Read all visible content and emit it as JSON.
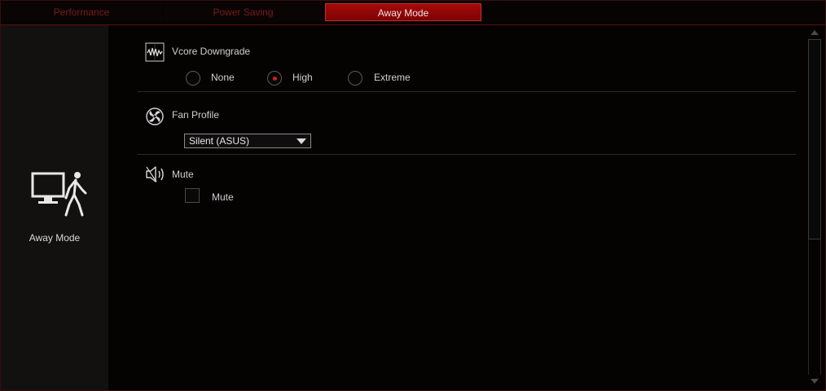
{
  "tabs": [
    {
      "label": "Performance"
    },
    {
      "label": "Power Saving"
    },
    {
      "label": "Away Mode"
    }
  ],
  "left_panel": {
    "icon": "away-mode-icon",
    "label": "Away Mode"
  },
  "vcore": {
    "title": "Vcore Downgrade",
    "icon": "vcore-waveform-icon",
    "options": [
      {
        "label": "None",
        "selected": false
      },
      {
        "label": "High",
        "selected": true
      },
      {
        "label": "Extreme",
        "selected": false
      }
    ]
  },
  "fan": {
    "title": "Fan Profile",
    "icon": "fan-icon",
    "selected": "Silent (ASUS)"
  },
  "mute": {
    "title": "Mute",
    "icon": "speaker-mute-icon",
    "checkbox_label": "Mute",
    "checked": false
  },
  "colors": {
    "accent": "#a50a0a",
    "radio_dot": "#e01818"
  }
}
